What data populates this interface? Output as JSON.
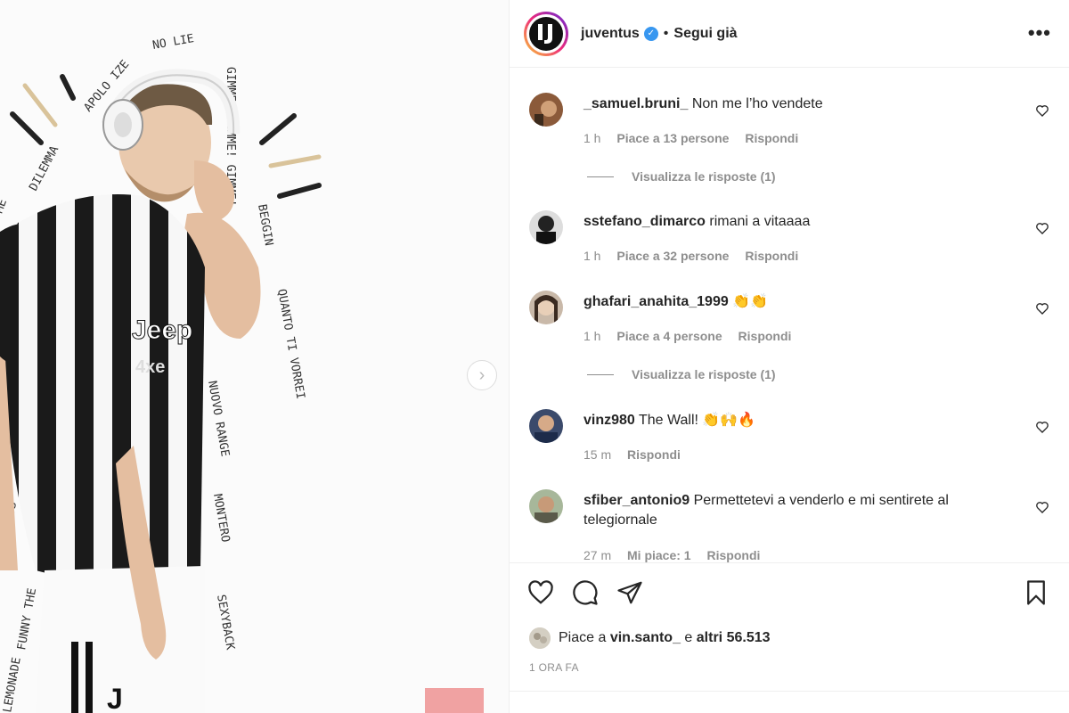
{
  "post": {
    "username": "juventus",
    "verified_icon": "verified-badge-icon",
    "separator": "•",
    "follow_label": "Segui già",
    "more_label": "•••"
  },
  "comments": [
    {
      "user": "_samuel.bruni_",
      "text": "Non me l’ho vendete",
      "time": "1 h",
      "likes": "Piace a 13 persone",
      "reply": "Rispondi",
      "view_replies": "Visualizza le risposte (1)"
    },
    {
      "user": "sstefano_dimarco",
      "text": "rimani a vitaaaa",
      "time": "1 h",
      "likes": "Piace a 32 persone",
      "reply": "Rispondi"
    },
    {
      "user": "ghafari_anahita_1999",
      "text": "👏👏",
      "time": "1 h",
      "likes": "Piace a 4 persone",
      "reply": "Rispondi",
      "view_replies": "Visualizza le risposte (1)"
    },
    {
      "user": "vinz980",
      "text": "The Wall! 👏🙌🔥",
      "time": "15 m",
      "reply": "Rispondi"
    },
    {
      "user": "sfiber_antonio9",
      "text": "Permettetevi a venderlo e mi sentirete al telegiornale",
      "time": "27 m",
      "likes": "Mi piace: 1",
      "reply": "Rispondi"
    }
  ],
  "likes_summary": {
    "prefix": "Piace a",
    "user": "vin.santo_",
    "middle": "e",
    "others": "altri 56.513"
  },
  "time_ago": "1 ORA FA",
  "image_text": {
    "no_lie": "NO LIE",
    "apologize": "APOLO IZE",
    "gimme": "GIMME! GIMME! GIMME!",
    "begin": "BEGGIN",
    "quanto": "QUANTO TI VORREI",
    "dilemma": "DILEMMA",
    "me": "ME",
    "nuovo": "NUOVO RANGE",
    "montero": "MONTERO",
    "sexyback": "SEXYBACK",
    "nights": "NIGHTS",
    "funny": "FUNNY THE",
    "lemonade": "LEMONADE",
    "sponsor": "Jeep",
    "sponsor2": "4xe"
  },
  "colors": {
    "accent": "#3897f0",
    "muted": "#8e8e8e",
    "text": "#262626"
  }
}
